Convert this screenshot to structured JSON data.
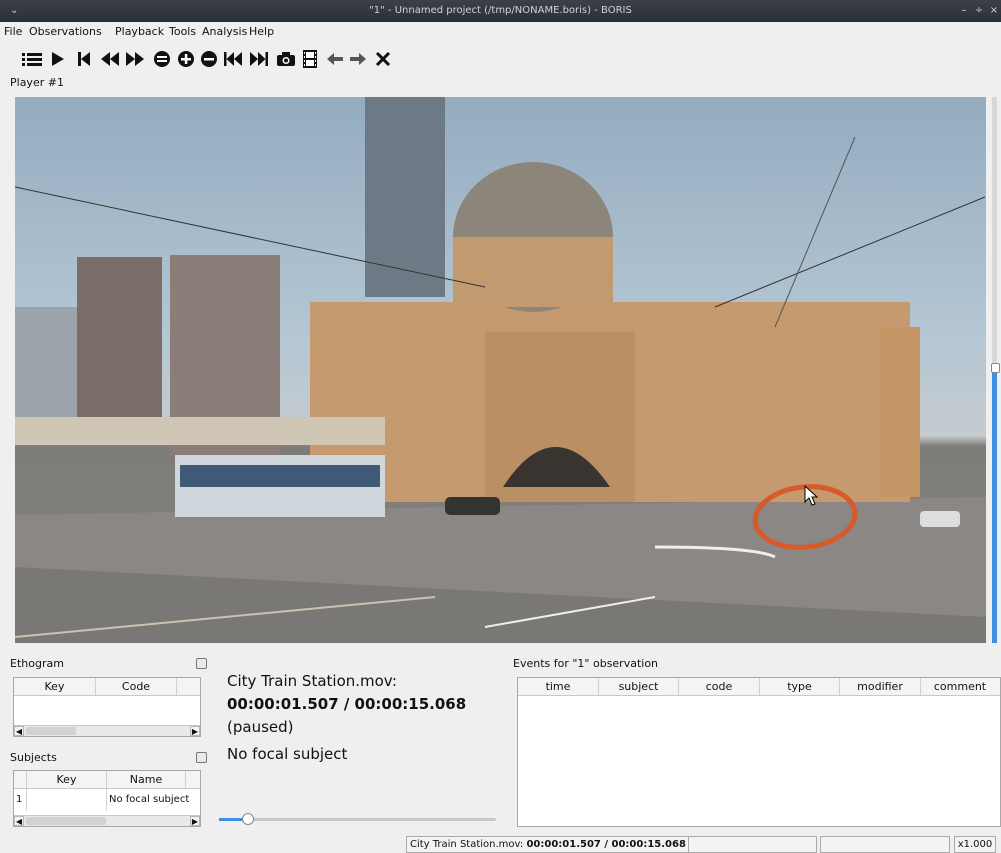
{
  "window": {
    "title": "\"1\" - Unnamed project (/tmp/NONAME.boris) - BORIS",
    "system_menu_icon": "chevron-down-icon",
    "controls": [
      "minimize-icon",
      "maximize-icon",
      "close-icon"
    ]
  },
  "menu": [
    "File",
    "Observations",
    "Playback",
    "Tools",
    "Analysis",
    "Help"
  ],
  "toolbar": {
    "icons": [
      "list-icon",
      "play-icon",
      "jump-start-icon",
      "rewind-icon",
      "fast-forward-icon",
      "zoom-fit-icon",
      "zoom-in-icon",
      "zoom-out-icon",
      "previous-media-icon",
      "next-media-icon",
      "snapshot-icon",
      "frame-by-frame-icon",
      "arrow-left-icon",
      "arrow-right-icon",
      "close-icon"
    ]
  },
  "player": {
    "label": "Player #1",
    "vertical_volume_level": 0.5
  },
  "ethogram": {
    "label": "Ethogram",
    "columns": [
      "Key",
      "Code"
    ],
    "rows": []
  },
  "subjects": {
    "label": "Subjects",
    "columns": [
      "Key",
      "Name"
    ],
    "rows": [
      {
        "index": "1",
        "key": "",
        "name": "No focal subject"
      }
    ]
  },
  "media_info": {
    "file": "City Train Station.mov:",
    "time": "00:00:01.507 / 00:00:15.068",
    "state": "(paused)",
    "focal_subject": "No focal subject"
  },
  "playback_position": 0.1,
  "events": {
    "label": "Events for \"1\" observation",
    "columns": [
      "time",
      "subject",
      "code",
      "type",
      "modifier",
      "comment"
    ],
    "rows": []
  },
  "statusbar": {
    "file_prefix": "City Train Station.mov:",
    "time": "00:00:01.507 / 00:00:15.068",
    "state": "(paused)",
    "speed": "x1.000"
  },
  "colors": {
    "accent": "#3d8fe0",
    "annotation": "#d65a2a"
  }
}
